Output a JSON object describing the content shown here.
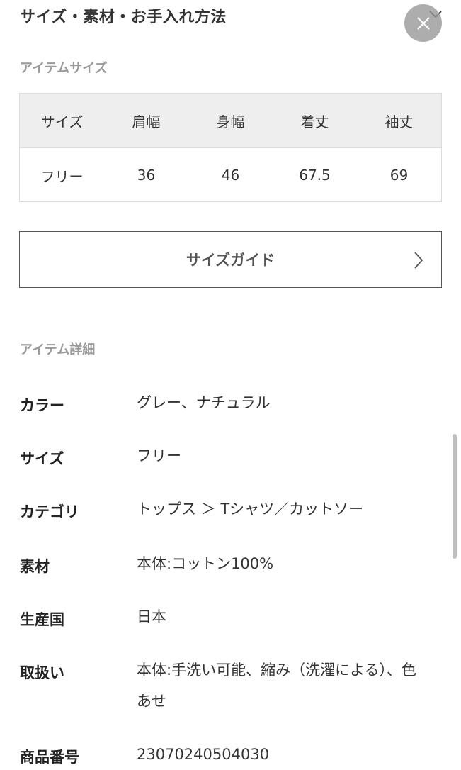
{
  "header": {
    "title": "サイズ・素材・お手入れ方法"
  },
  "icons": {
    "close": "close-icon",
    "chevron": "chevron-down-icon",
    "guide_arrow": "chevron-right-icon"
  },
  "item_size": {
    "label": "アイテムサイズ",
    "headers": [
      "サイズ",
      "肩幅",
      "身幅",
      "着丈",
      "袖丈"
    ],
    "rows": [
      [
        "フリー",
        "36",
        "46",
        "67.5",
        "69"
      ]
    ]
  },
  "size_guide": {
    "label": "サイズガイド"
  },
  "item_details": {
    "label": "アイテム詳細",
    "rows": [
      {
        "key": "カラー",
        "value": "グレー、ナチュラル"
      },
      {
        "key": "サイズ",
        "value": "フリー"
      },
      {
        "key": "カテゴリ",
        "value": "トップス ＞ Tシャツ／カットソー"
      },
      {
        "key": "素材",
        "value": "本体:コットン100%"
      },
      {
        "key": "生産国",
        "value": "日本"
      },
      {
        "key": "取扱い",
        "value": "本体:手洗い可能、縮み（洗濯による）、色あせ"
      },
      {
        "key": "商品番号",
        "value": "23070240504030"
      }
    ]
  },
  "colors": {
    "table_header_bg": "#eeeeee",
    "section_label": "#9a9a9a",
    "close_button_bg": "#969696"
  }
}
